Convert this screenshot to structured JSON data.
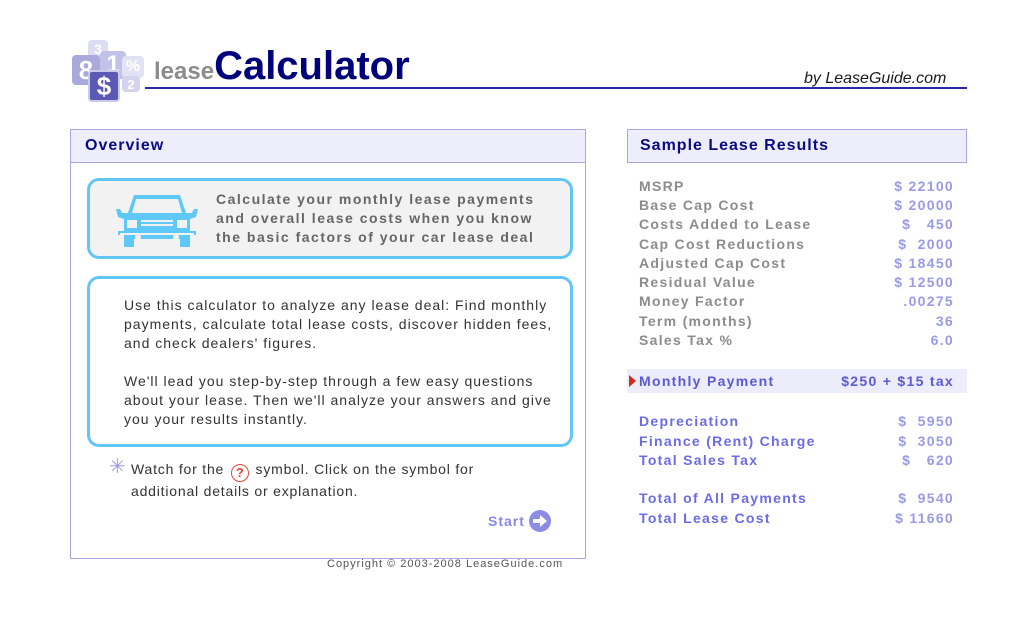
{
  "header": {
    "logo_tiles": [
      "3",
      "8",
      "1",
      "%",
      "2",
      "$"
    ],
    "brand_prefix": "lease",
    "brand_name": "Calculator",
    "byline": "by LeaseGuide.com"
  },
  "overview": {
    "title": "Overview",
    "intro": "Calculate your monthly lease payments and overall lease costs when you know the basic factors of your car lease deal",
    "paragraphs": [
      "Use this calculator to analyze any lease deal: Find monthly payments, calculate total lease costs, discover hidden fees, and check dealers' figures.",
      "We'll lead you step-by-step through a few easy questions about your lease. Then we'll analyze your answers and give you your results instantly."
    ],
    "note_before": "Watch for the",
    "note_symbol": "?",
    "note_after": "symbol. Click on the symbol for additional details or explanation.",
    "start_label": "Start",
    "copyright": "Copyright © 2003-2008 LeaseGuide.com"
  },
  "results": {
    "title": "Sample Lease Results",
    "inputs": [
      {
        "label": "MSRP",
        "value": "$ 22100"
      },
      {
        "label": "Base Cap Cost",
        "value": "$ 20000"
      },
      {
        "label": "Costs Added to Lease",
        "value": "$   450"
      },
      {
        "label": "Cap Cost Reductions",
        "value": "$  2000"
      },
      {
        "label": "Adjusted Cap Cost",
        "value": "$ 18450"
      },
      {
        "label": "Residual Value",
        "value": "$ 12500"
      },
      {
        "label": "Money Factor",
        "value": ".00275"
      },
      {
        "label": "Term (months)",
        "value": "36"
      },
      {
        "label": "Sales Tax %",
        "value": "6.0"
      }
    ],
    "monthly_payment": {
      "label": "Monthly Payment",
      "value": "$250 + $15 tax"
    },
    "breakdown": [
      {
        "label": "Depreciation",
        "value": "$  5950"
      },
      {
        "label": "Finance (Rent) Charge",
        "value": "$  3050"
      },
      {
        "label": "Total Sales Tax",
        "value": "$   620"
      }
    ],
    "totals": [
      {
        "label": "Total of All Payments",
        "value": "$  9540"
      },
      {
        "label": "Total Lease Cost",
        "value": "$ 11660"
      }
    ]
  }
}
